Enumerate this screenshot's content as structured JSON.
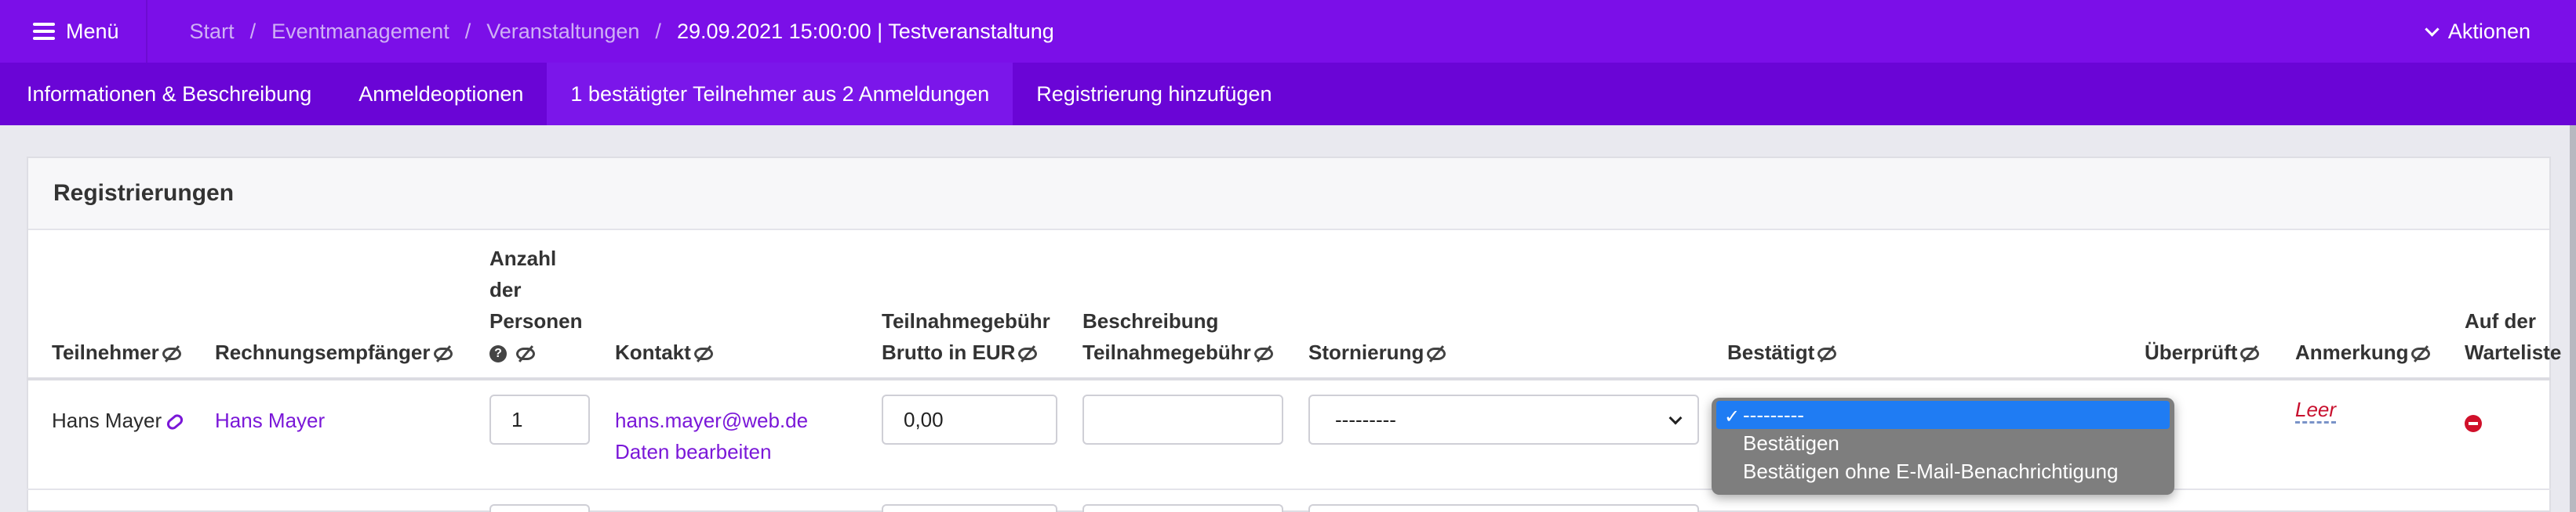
{
  "topbar": {
    "menu_label": "Menü",
    "breadcrumb": [
      "Start",
      "Eventmanagement",
      "Veranstaltungen"
    ],
    "current": "29.09.2021 15:00:00 | Testveranstaltung",
    "actions_label": "Aktionen"
  },
  "tabs": [
    {
      "label": "Informationen & Beschreibung"
    },
    {
      "label": "Anmeldeoptionen"
    },
    {
      "label": "1 bestätigter Teilnehmer aus 2 Anmeldungen"
    },
    {
      "label": "Registrierung hinzufügen"
    }
  ],
  "card": {
    "title": "Registrierungen"
  },
  "columns": {
    "teilnehmer": "Teilnehmer",
    "rechnung": "Rechnungsempfänger",
    "anzahl_1": "Anzahl",
    "anzahl_2": "der",
    "anzahl_3": "Personen",
    "kontakt": "Kontakt",
    "gebuehr_1": "Teilnahmegebühr",
    "gebuehr_2": "Brutto in EUR",
    "beschreibung_1": "Beschreibung",
    "beschreibung_2": "Teilnahmegebühr",
    "stornierung": "Stornierung",
    "bestaetigt": "Bestätigt",
    "ueberprueft": "Überprüft",
    "anmerkung": "Anmerkung",
    "warteliste_1": "Auf der",
    "warteliste_2": "Warteliste"
  },
  "row": {
    "teilnehmer": "Hans Mayer",
    "rechnung": "Hans Mayer",
    "anzahl": "1",
    "email": "hans.mayer@web.de",
    "edit_link": "Daten bearbeiten",
    "gebuehr": "0,00",
    "beschreibung": "",
    "stornierung": "---------",
    "anmerkung": "Leer"
  },
  "dropdown": {
    "options": [
      "---------",
      "Bestätigen",
      "Bestätigen ohne E-Mail-Benachrichtigung"
    ],
    "selected": "---------"
  },
  "colors": {
    "topbar": "#7b0fe8",
    "tabbar": "#6a05d6",
    "link": "#7a17d8",
    "selection": "#1f7cf3",
    "danger": "#d0102a"
  }
}
